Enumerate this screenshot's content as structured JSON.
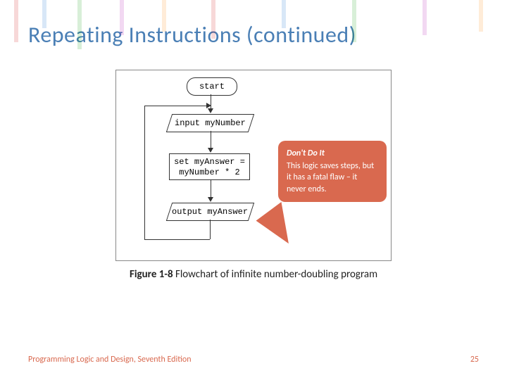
{
  "title": "Repeating Instructions (continued)",
  "flowchart": {
    "start": "start",
    "input": "input myNumber",
    "process_line1": "set myAnswer =",
    "process_line2": "myNumber * 2",
    "output": "output myAnswer"
  },
  "callout": {
    "heading": "Don't Do It",
    "body": "This logic saves steps, but it has a fatal flaw – it never ends."
  },
  "caption_bold": "Figure 1-8",
  "caption_rest": " Flowchart of infinite number-doubling program",
  "footer": "Programming Logic and Design, Seventh Edition",
  "page_number": "25"
}
